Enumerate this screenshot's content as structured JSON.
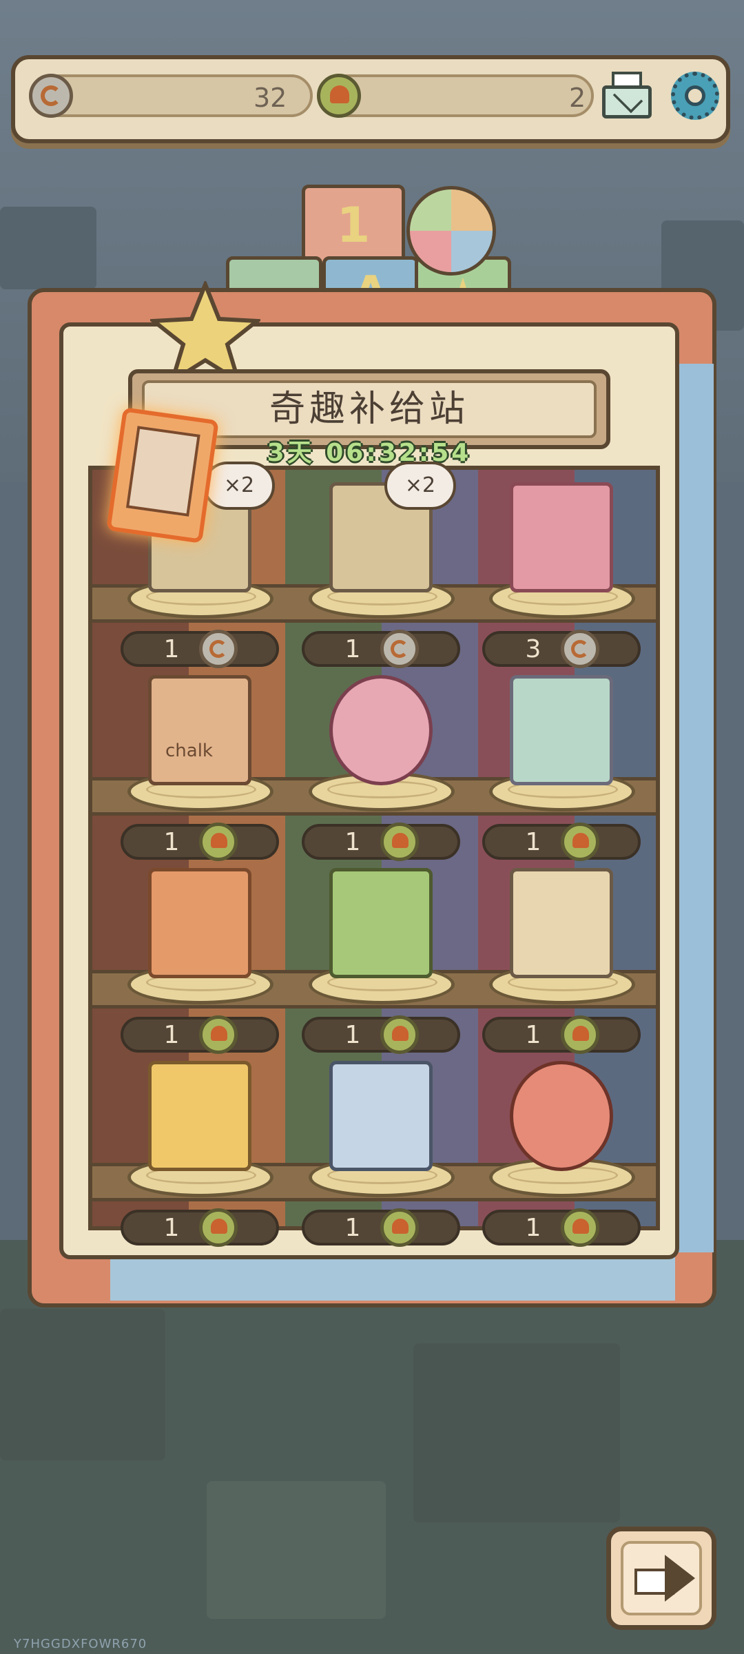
{
  "top_bar": {
    "swirl_coin_count": "32",
    "shell_coin_count": "2",
    "mail_icon": "mail-icon",
    "settings_icon": "gear-icon"
  },
  "shop": {
    "title": "奇趣补给站",
    "timer": "3天 06:32:54",
    "block_labels": [
      "1",
      "A"
    ],
    "items": [
      {
        "name": "snack-bag",
        "price": "1",
        "currency": "swirl",
        "bubble": "×2"
      },
      {
        "name": "snack-bag",
        "price": "1",
        "currency": "swirl",
        "bubble": "×2"
      },
      {
        "name": "sticker-card",
        "price": "3",
        "currency": "swirl",
        "bubble": ""
      },
      {
        "name": "chalk-box",
        "price": "1",
        "currency": "shell",
        "bubble": "",
        "label": "chalk"
      },
      {
        "name": "pink-tin",
        "price": "1",
        "currency": "shell",
        "bubble": ""
      },
      {
        "name": "jelly-cups",
        "price": "1",
        "currency": "shell",
        "bubble": ""
      },
      {
        "name": "popping-candy",
        "price": "1",
        "currency": "shell",
        "bubble": ""
      },
      {
        "name": "green-popsicle",
        "price": "1",
        "currency": "shell",
        "bubble": ""
      },
      {
        "name": "jerky-pack",
        "price": "1",
        "currency": "shell",
        "bubble": ""
      },
      {
        "name": "ticket-card",
        "price": "1",
        "currency": "shell",
        "bubble": ""
      },
      {
        "name": "eraser",
        "price": "1",
        "currency": "shell",
        "bubble": ""
      },
      {
        "name": "tower-badge",
        "price": "1",
        "currency": "shell",
        "bubble": ""
      }
    ]
  },
  "next_button_icon": "arrow-right-icon",
  "watermark": "Y7HGGDXFOWR670",
  "colors": {
    "frame_brown": "#5a4732",
    "panel_cream": "#f0e4c6",
    "timer_green": "#b7e08c"
  }
}
